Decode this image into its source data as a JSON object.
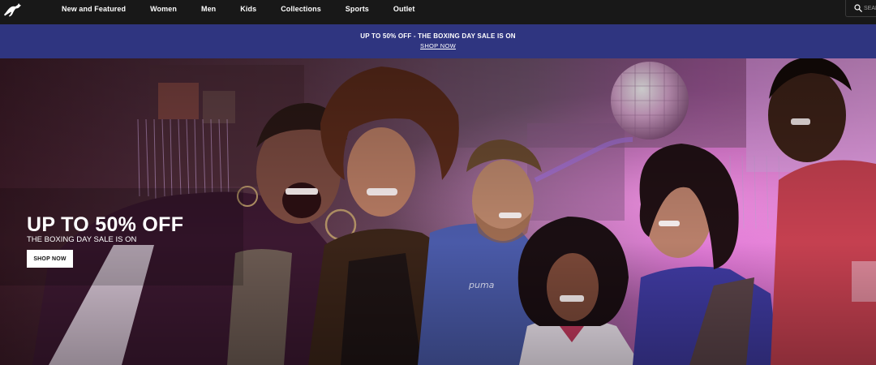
{
  "header": {
    "logo": "puma-cat-logo",
    "nav": [
      "New and Featured",
      "Women",
      "Men",
      "Kids",
      "Collections",
      "Sports",
      "Outlet"
    ],
    "search": {
      "placeholder": "SEARCH",
      "icon": "search-icon"
    }
  },
  "promo_bar": {
    "text": "UP TO 50% OFF - THE BOXING DAY SALE IS ON",
    "link": "SHOP NOW",
    "background": "#2f3580"
  },
  "hero": {
    "title": "UP TO 50% OFF",
    "subtitle": "THE BOXING DAY SALE IS ON",
    "cta": "SHOP NOW",
    "shirt_text": "puma"
  }
}
